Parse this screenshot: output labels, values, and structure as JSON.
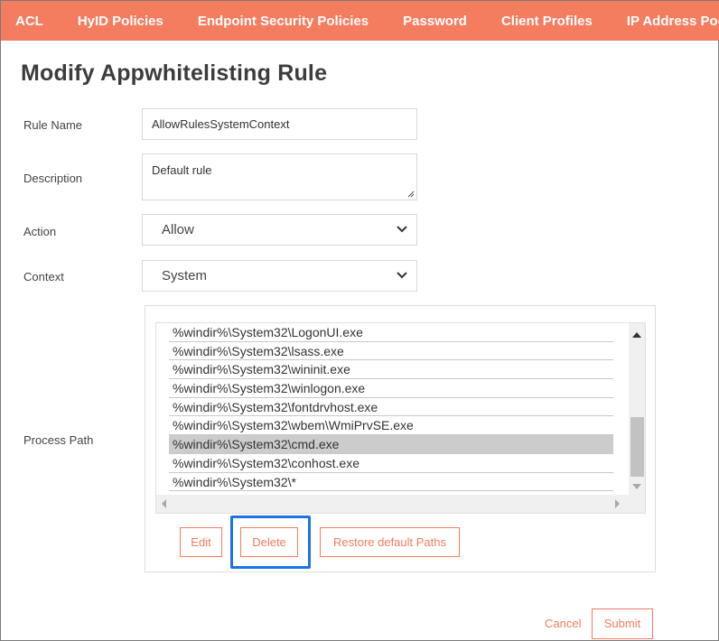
{
  "nav": {
    "tabs": [
      "ACL",
      "HyID Policies",
      "Endpoint Security Policies",
      "Password",
      "Client Profiles",
      "IP Address Pools"
    ]
  },
  "page": {
    "title": "Modify Appwhitelisting Rule"
  },
  "form": {
    "rule_name": {
      "label": "Rule Name",
      "value": "AllowRulesSystemContext"
    },
    "description": {
      "label": "Description",
      "value": "Default rule"
    },
    "action": {
      "label": "Action",
      "value": "Allow"
    },
    "context": {
      "label": "Context",
      "value": "System"
    },
    "process_path": {
      "label": "Process Path",
      "items": [
        "%windir%\\System32\\LogonUI.exe",
        "%windir%\\System32\\lsass.exe",
        "%windir%\\System32\\wininit.exe",
        "%windir%\\System32\\winlogon.exe",
        "%windir%\\System32\\fontdrvhost.exe",
        "%windir%\\System32\\wbem\\WmiPrvSE.exe",
        "%windir%\\System32\\cmd.exe",
        "%windir%\\System32\\conhost.exe",
        "%windir%\\System32\\*"
      ],
      "selected_item": "%windir%\\System32\\cmd.exe",
      "buttons": {
        "edit": "Edit",
        "delete": "Delete",
        "restore": "Restore default Paths"
      }
    }
  },
  "footer": {
    "cancel": "Cancel",
    "submit": "Submit"
  },
  "colors": {
    "accent": "#f47c5f",
    "highlight": "#1a73e8",
    "selected_row": "#cccccc"
  }
}
